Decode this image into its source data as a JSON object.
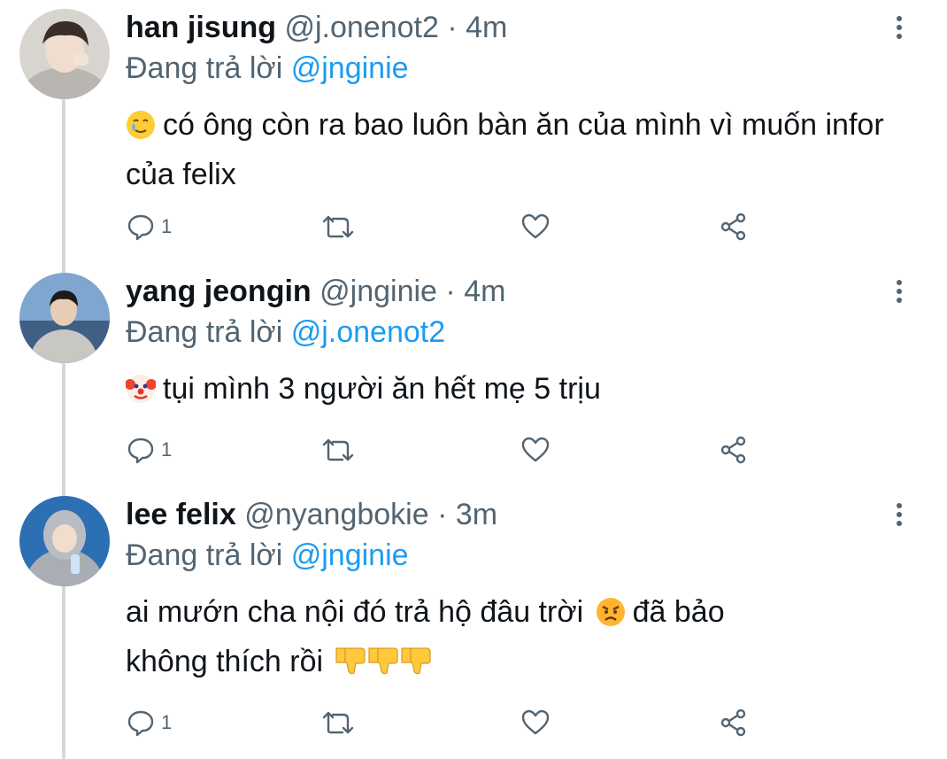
{
  "tweets": [
    {
      "name": "han jisung",
      "handle": "@j.onenot2",
      "separator": "·",
      "time": "4m",
      "reply_prefix": "Đang trả lời",
      "reply_to": "@jnginie",
      "emoji_lead": "crying-smile-emoji",
      "text": "có ông còn ra bao luôn bàn ăn của mình vì muốn infor của felix",
      "reply_count": "1"
    },
    {
      "name": "yang jeongin",
      "handle": "@jnginie",
      "separator": "·",
      "time": "4m",
      "reply_prefix": "Đang trả lời",
      "reply_to": "@j.onenot2",
      "emoji_lead": "clown-emoji",
      "text": "tụi mình 3 người ăn hết mẹ 5 trịu",
      "reply_count": "1"
    },
    {
      "name": "lee felix",
      "handle": "@nyangbokie",
      "separator": "·",
      "time": "3m",
      "reply_prefix": "Đang trả lời",
      "reply_to": "@jnginie",
      "text_part1": "ai mướn cha nội đó trả hộ đâu trời",
      "emoji_mid": "angry-face-emoji",
      "text_part2": "đã bảo",
      "text_line2": "không thích rồi",
      "emoji_trail": "thumbs-down-emoji x3",
      "reply_count": "1"
    }
  ],
  "colors": {
    "accent": "#1d9bf0",
    "muted": "#536471",
    "text": "#0f1419",
    "thread_line": "#cfd9de"
  },
  "icons": [
    "reply-icon",
    "retweet-icon",
    "like-icon",
    "share-icon",
    "more-icon"
  ]
}
